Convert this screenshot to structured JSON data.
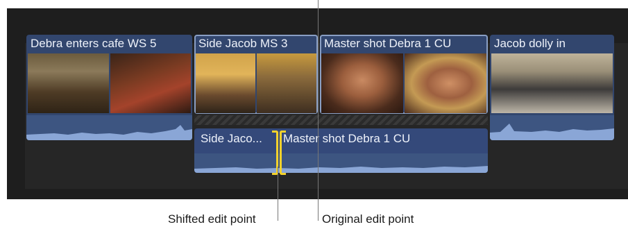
{
  "clips": {
    "debra_enters": {
      "title": "Debra enters cafe WS 5"
    },
    "side_jacob": {
      "title": "Side Jacob MS 3"
    },
    "master_debra": {
      "title": "Master shot Debra 1 CU"
    },
    "jacob_dolly": {
      "title": "Jacob dolly in"
    }
  },
  "connected": {
    "side_jacob_trunc": "Side Jaco...",
    "master_debra": "Master shot Debra 1 CU"
  },
  "captions": {
    "shifted": "Shifted edit point",
    "original": "Original edit point"
  },
  "colors": {
    "clip_blue": "#32466e",
    "audio_blue": "#3d5581",
    "selection_yellow": "#f3d22c",
    "timeline_bg": "#1e1e1e"
  },
  "icons": [
    "edit-point-bracket-icon"
  ]
}
